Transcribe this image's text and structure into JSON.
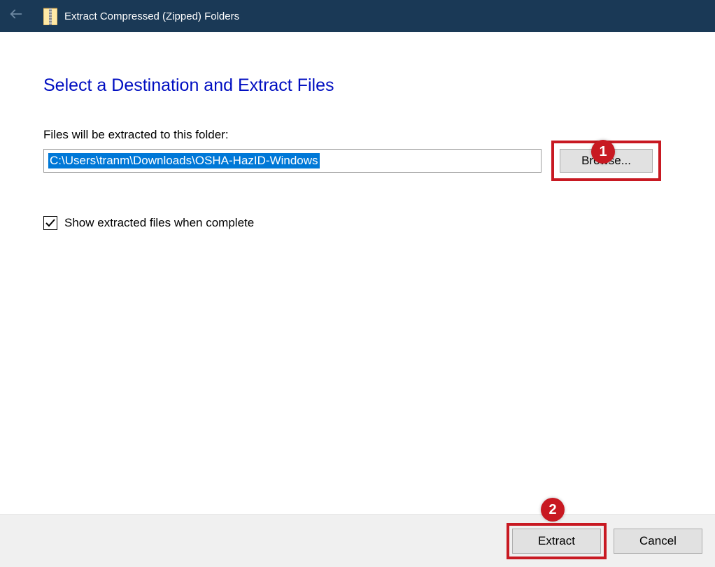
{
  "titlebar": {
    "title": "Extract Compressed (Zipped) Folders"
  },
  "main": {
    "heading": "Select a Destination and Extract Files",
    "path_label": "Files will be extracted to this folder:",
    "path_value": "C:\\Users\\tranm\\Downloads\\OSHA-HazID-Windows",
    "browse_label": "Browse...",
    "show_extracted_label": "Show extracted files when complete",
    "show_extracted_checked": true
  },
  "footer": {
    "extract_label": "Extract",
    "cancel_label": "Cancel"
  },
  "annotations": {
    "badge1": "1",
    "badge2": "2"
  },
  "colors": {
    "titlebar_bg": "#1a3956",
    "heading_color": "#000ec1",
    "selection_bg": "#0078d7",
    "annotation_red": "#c81922",
    "button_bg": "#e1e1e1",
    "footer_bg": "#f0f0f0"
  }
}
